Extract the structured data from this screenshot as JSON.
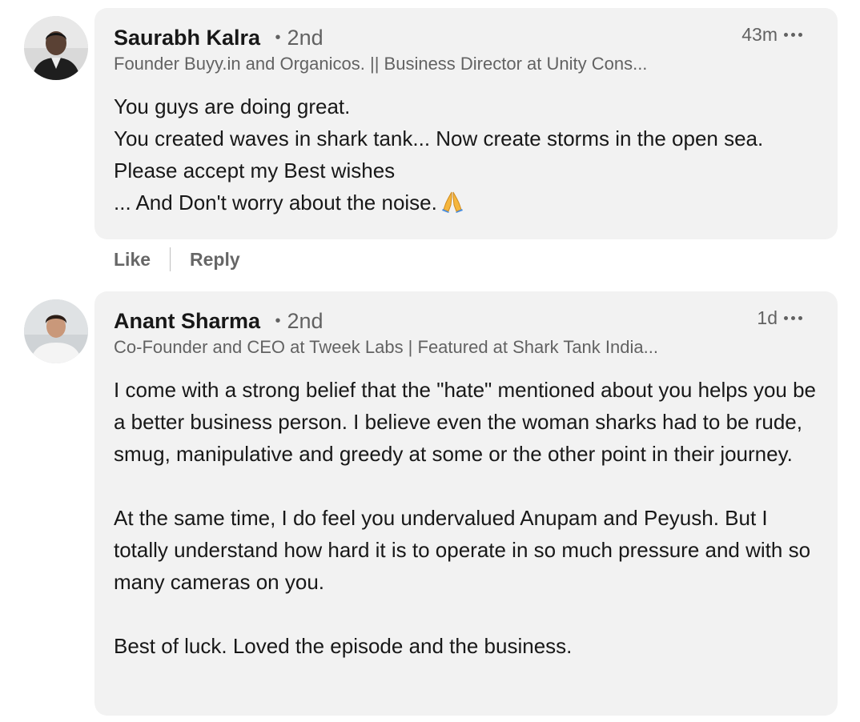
{
  "comments": [
    {
      "author": "Saurabh Kalra",
      "degree": "2nd",
      "headline": "Founder Buyy.in and Organicos. || Business Director at Unity Cons...",
      "time": "43m",
      "avatar_icon": "person-photo-icon",
      "lines": [
        "You guys are doing great.",
        "You created waves in shark tank... Now create storms in the open sea. Please accept my Best wishes",
        "... And Don't worry about the noise."
      ],
      "emoji": "folded-hands-icon",
      "actions": {
        "like": "Like",
        "reply": "Reply"
      }
    },
    {
      "author": "Anant Sharma",
      "degree": "2nd",
      "headline": "Co-Founder and CEO at Tweek Labs | Featured at Shark Tank India...",
      "time": "1d",
      "avatar_icon": "person-photo-icon",
      "paragraphs": [
        "I come with a strong belief that the \"hate\" mentioned about you helps you be a better business person. I believe even the woman sharks had to be rude, smug, manipulative and greedy at some or the other point in their journey.",
        "At the same time, I do feel you undervalued Anupam and Peyush. But I totally understand how hard it is to operate in so much pressure and with so many cameras on you.",
        "Best of luck. Loved the episode and the business."
      ]
    }
  ],
  "colors": {
    "bubble_bg": "#f2f2f2",
    "text_primary": "rgba(0,0,0,0.9)",
    "text_secondary": "rgba(0,0,0,0.6)"
  }
}
